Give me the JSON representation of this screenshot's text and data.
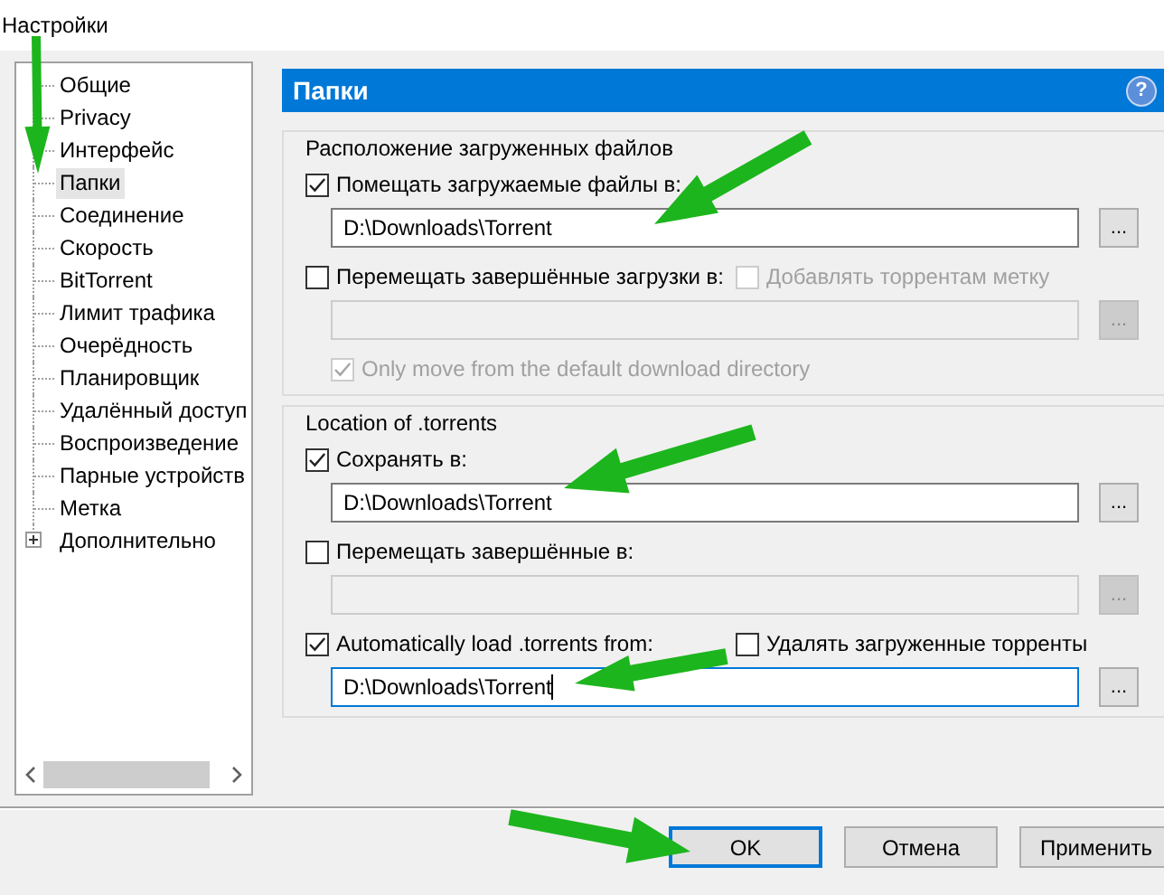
{
  "window": {
    "title": "Настройки"
  },
  "sidebar": {
    "items": [
      {
        "label": "Общие",
        "selected": false,
        "kind": "leaf"
      },
      {
        "label": "Privacy",
        "selected": false,
        "kind": "leaf"
      },
      {
        "label": "Интерфейс",
        "selected": false,
        "kind": "leaf"
      },
      {
        "label": "Папки",
        "selected": true,
        "kind": "leaf"
      },
      {
        "label": "Соединение",
        "selected": false,
        "kind": "leaf"
      },
      {
        "label": "Скорость",
        "selected": false,
        "kind": "leaf"
      },
      {
        "label": "BitTorrent",
        "selected": false,
        "kind": "leaf"
      },
      {
        "label": "Лимит трафика",
        "selected": false,
        "kind": "leaf"
      },
      {
        "label": "Очерёдность",
        "selected": false,
        "kind": "leaf"
      },
      {
        "label": "Планировщик",
        "selected": false,
        "kind": "leaf"
      },
      {
        "label": "Удалённый доступ",
        "selected": false,
        "kind": "leaf"
      },
      {
        "label": "Воспроизведение",
        "selected": false,
        "kind": "leaf"
      },
      {
        "label": "Парные устройств",
        "selected": false,
        "kind": "leaf"
      },
      {
        "label": "Метка",
        "selected": false,
        "kind": "leaf"
      },
      {
        "label": "Дополнительно",
        "selected": false,
        "kind": "expander"
      }
    ]
  },
  "panel": {
    "title": "Папки",
    "help": "?",
    "groups": [
      {
        "legend": "Расположение загруженных файлов",
        "rows": [
          {
            "kind": "checks",
            "items": [
              {
                "label": "Помещать загружаемые файлы в:",
                "checked": true,
                "disabled": false
              }
            ]
          },
          {
            "kind": "path",
            "value": "D:\\Downloads\\Torrent",
            "disabled": false,
            "focused": false,
            "button": "..."
          },
          {
            "kind": "checks",
            "items": [
              {
                "label": "Перемещать завершённые загрузки в:",
                "checked": false,
                "disabled": false
              },
              {
                "label": "Добавлять торрентам метку",
                "checked": false,
                "disabled": true
              }
            ]
          },
          {
            "kind": "path",
            "disabled": true,
            "focused": false,
            "button": "..."
          },
          {
            "kind": "subcheck",
            "items": [
              {
                "label": "Only move from the default download directory",
                "checked": true,
                "disabled": true
              }
            ]
          }
        ]
      },
      {
        "legend": "Location of .torrents",
        "rows": [
          {
            "kind": "checks",
            "items": [
              {
                "label": "Сохранять в:",
                "checked": true,
                "disabled": false
              }
            ]
          },
          {
            "kind": "path",
            "value": "D:\\Downloads\\Torrent",
            "disabled": false,
            "focused": false,
            "button": "..."
          },
          {
            "kind": "checks",
            "items": [
              {
                "label": "Перемещать завершённые в:",
                "checked": false,
                "disabled": false
              }
            ]
          },
          {
            "kind": "path",
            "disabled": true,
            "focused": false,
            "button": "..."
          },
          {
            "kind": "checks",
            "items": [
              {
                "label": "Automatically load .torrents from:",
                "checked": true,
                "disabled": false
              },
              {
                "label": "Удалять загруженные торренты",
                "checked": false,
                "disabled": false
              }
            ]
          },
          {
            "kind": "path",
            "value": "D:\\Downloads\\Torrent",
            "disabled": false,
            "focused": true,
            "button": "..."
          }
        ]
      }
    ]
  },
  "buttons": [
    {
      "label": "OK",
      "default": true
    },
    {
      "label": "Отмена",
      "default": false
    },
    {
      "label": "Применить",
      "default": false
    }
  ]
}
